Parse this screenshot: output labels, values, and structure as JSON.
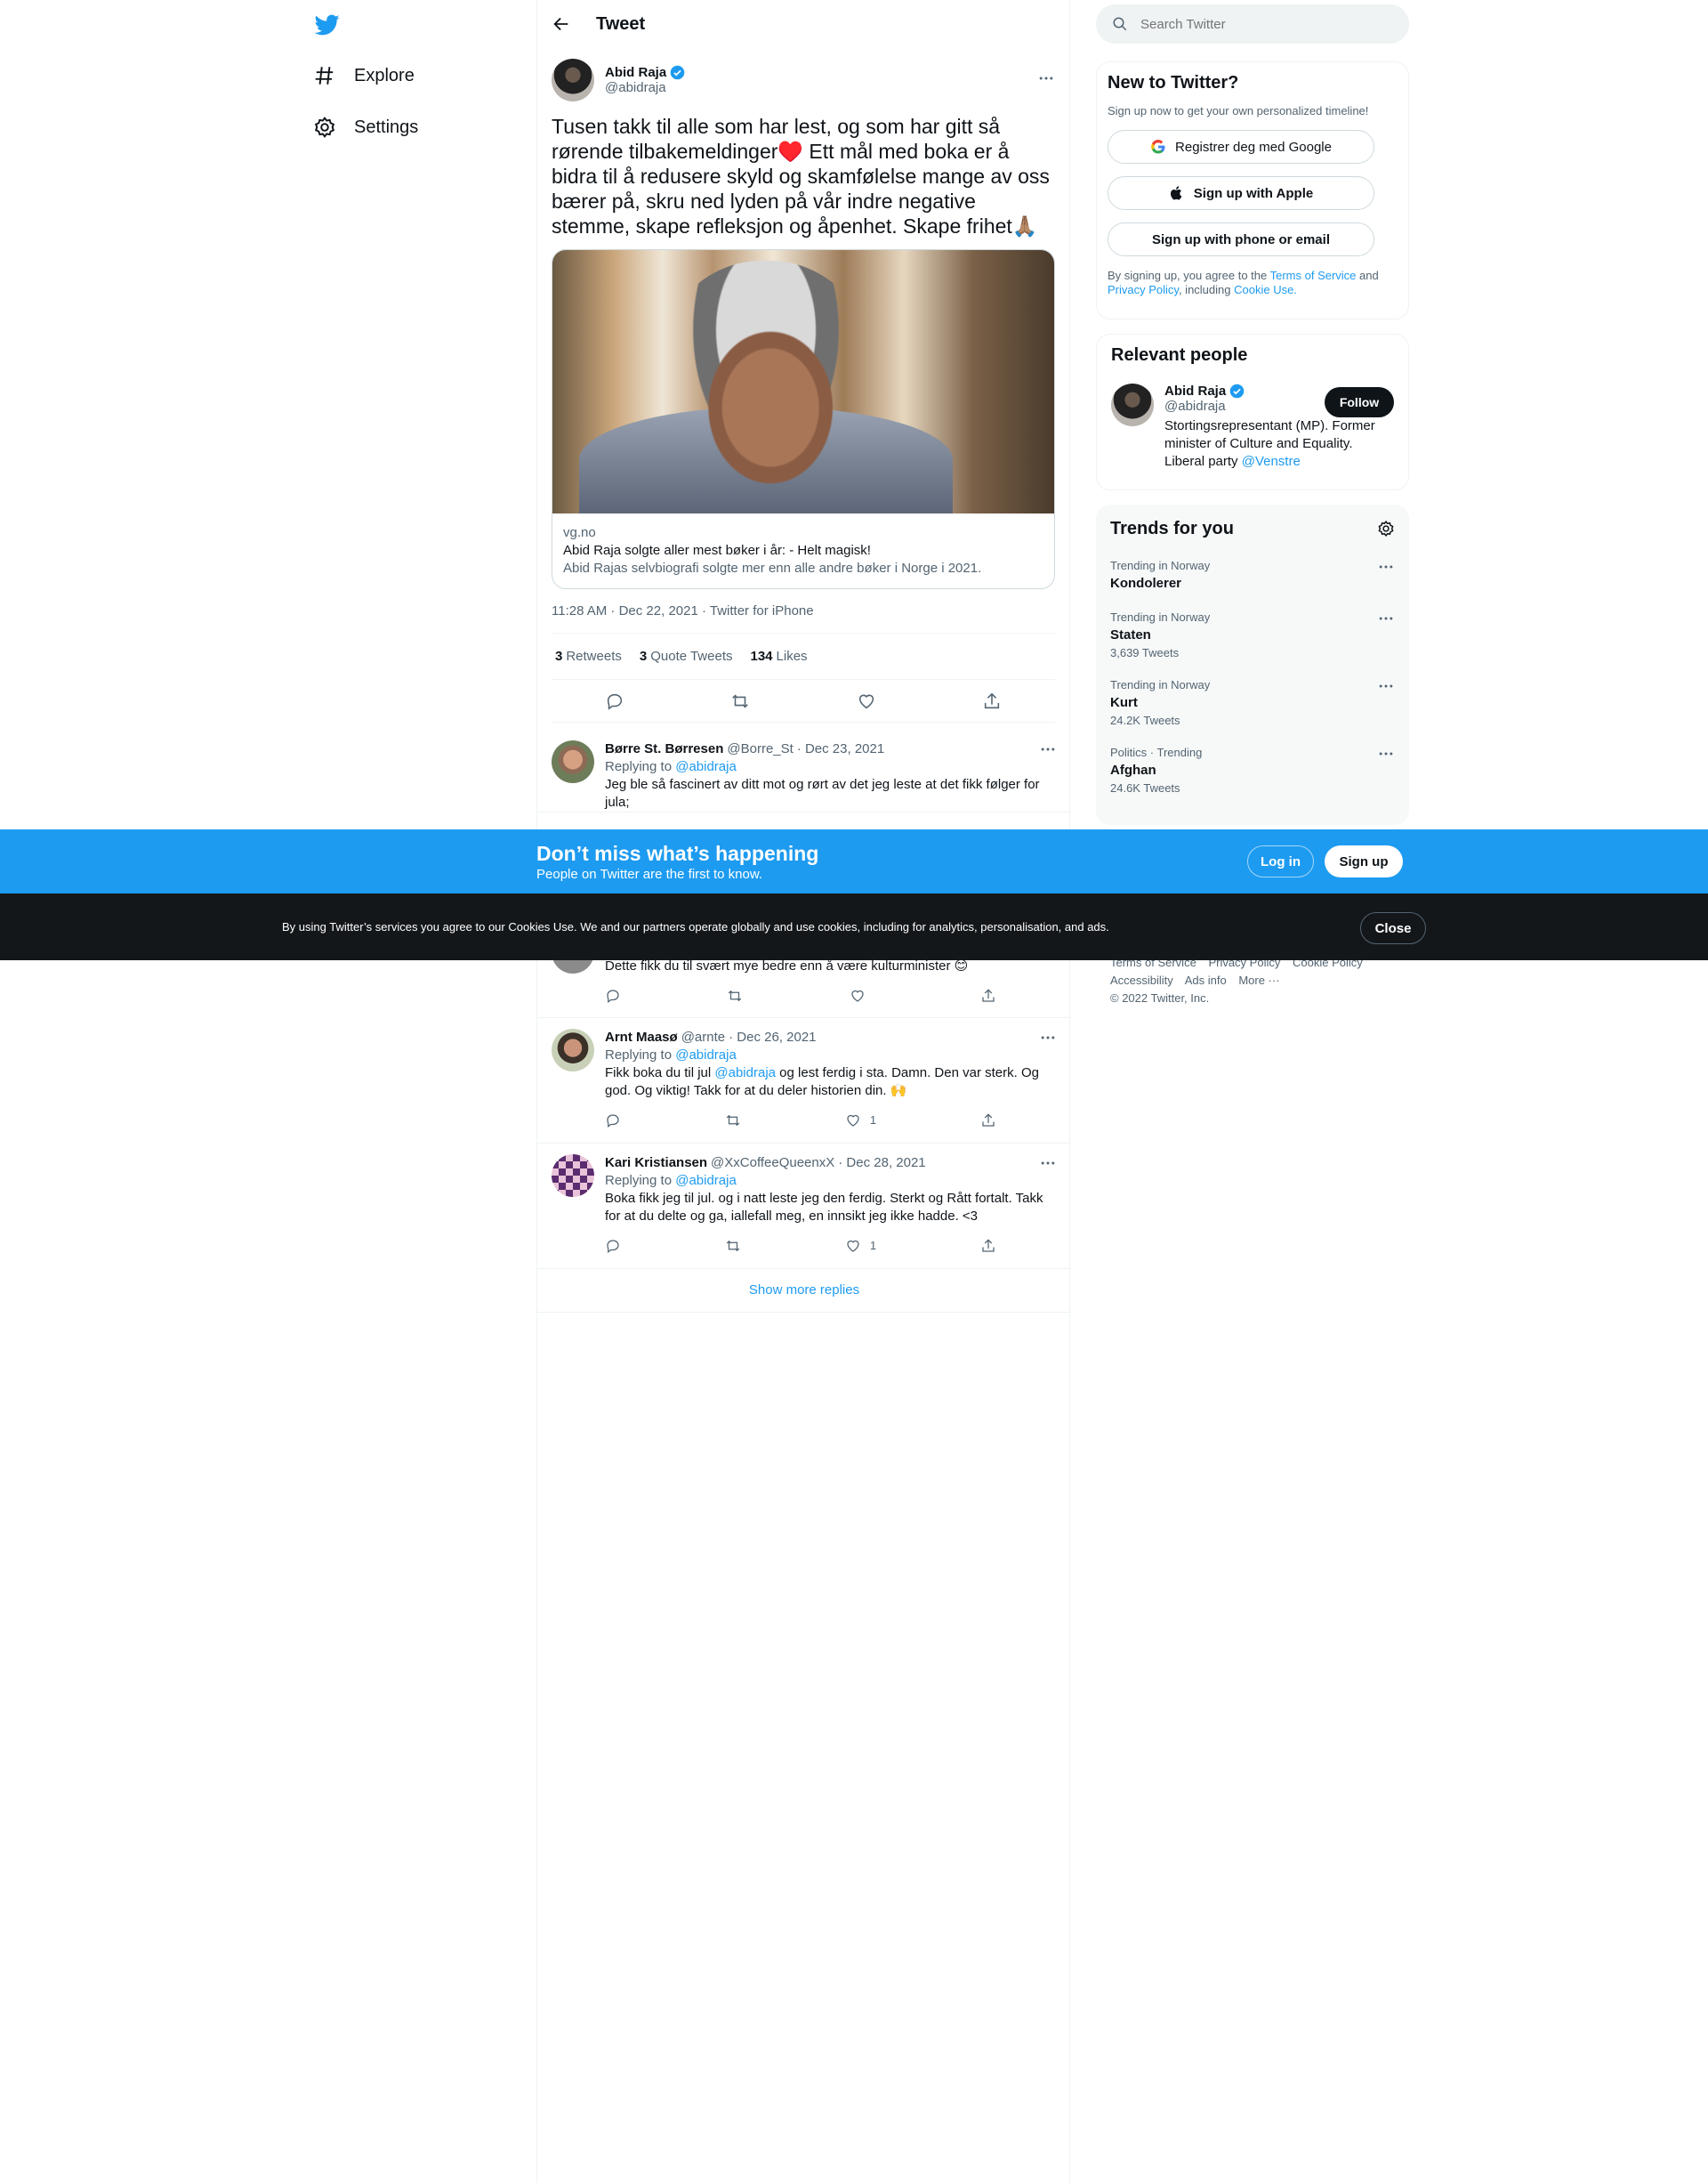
{
  "nav": {
    "explore_label": "Explore",
    "settings_label": "Settings"
  },
  "header": {
    "title": "Tweet"
  },
  "tweet": {
    "author_name": "Abid Raja",
    "author_handle": "@abidraja",
    "text": "Tusen takk til alle som har lest, og som har gitt så rørende tilbakemeldinger♥️ Ett mål med boka er å bidra til å redusere skyld og skamfølelse mange av oss bærer på, skru ned lyden på vår indre negative stemme, skape refleksjon og åpenhet. Skape frihet🙏🏽",
    "card": {
      "domain": "vg.no",
      "title": "Abid Raja solgte aller mest bøker i år: - Helt magisk!",
      "description": "Abid Rajas selvbiografi solgte mer enn alle andre bøker i Norge i 2021."
    },
    "meta": "11:28 AM · Dec 22, 2021 · Twitter for iPhone",
    "retweets_count": "3",
    "retweets_label": "Retweets",
    "quotes_count": "3",
    "quotes_label": "Quote Tweets",
    "likes_count": "134",
    "likes_label": "Likes"
  },
  "replies": [
    {
      "name": "Børre St. Børresen",
      "handle": "@Borre_St",
      "date": "· Dec 23, 2021",
      "replying_prefix": "Replying to ",
      "replying_to": "@abidraja",
      "text": "Jeg ble så fascinert av ditt mot og rørt av det jeg leste at det fikk følger for jula;",
      "likes": ""
    },
    {
      "text": "Dette fikk du til svært mye bedre enn å være kulturminister 😊",
      "likes": ""
    },
    {
      "name": "Arnt Maasø",
      "handle": "@arnte",
      "date": "· Dec 26, 2021",
      "replying_prefix": "Replying to ",
      "replying_to": "@abidraja",
      "text_before": "Fikk boka du til jul ",
      "text_mention": "@abidraja",
      "text_after": " og lest ferdig i sta. Damn. Den var sterk. Og god. Og viktig! Takk for at du deler historien din. 🙌",
      "likes": "1"
    },
    {
      "name": "Kari Kristiansen",
      "handle": "@XxCoffeeQueenxX",
      "date": "· Dec 28, 2021",
      "replying_prefix": "Replying to ",
      "replying_to": "@abidraja",
      "text": "Boka fikk jeg til jul. og i natt leste jeg den ferdig. Sterkt og Rått fortalt. Takk for at du delte og ga, iallefall meg, en innsikt jeg ikke hadde. <3",
      "likes": "1"
    }
  ],
  "show_more": "Show more replies",
  "search": {
    "placeholder": "Search Twitter"
  },
  "new_to_twitter": {
    "title": "New to Twitter?",
    "subtitle": "Sign up now to get your own personalized timeline!",
    "google_label": "Registrer deg med Google",
    "apple_label": "Sign up with Apple",
    "phone_label": "Sign up with phone or email",
    "legal_1": "By signing up, you agree to the ",
    "tos": "Terms of Service",
    "legal_2": " and ",
    "privacy": "Privacy Policy",
    "legal_3": ", including ",
    "cookie": "Cookie Use."
  },
  "relevant": {
    "title": "Relevant people",
    "name": "Abid Raja",
    "handle": "@abidraja",
    "follow_label": "Follow",
    "bio": "Stortingsrepresentant (MP). Former minister of Culture and Equality. Liberal party ",
    "bio_link": "@Venstre"
  },
  "trends": {
    "title": "Trends for you",
    "items": [
      {
        "context": "Trending in Norway",
        "name": "Kondolerer",
        "count": ""
      },
      {
        "context": "Trending in Norway",
        "name": "Staten",
        "count": "3,639 Tweets"
      },
      {
        "context": "Trending in Norway",
        "name": "Kurt",
        "count": "24.2K Tweets"
      },
      {
        "context": "Politics · Trending",
        "name": "Afghan",
        "count": "24.6K Tweets"
      }
    ]
  },
  "footer": {
    "tos": "Terms of Service",
    "privacy": "Privacy Policy",
    "cookie": "Cookie Policy",
    "accessibility": "Accessibility",
    "ads": "Ads info",
    "more": "More ···",
    "copyright": "© 2022 Twitter, Inc."
  },
  "banner": {
    "title": "Don’t miss what’s happening",
    "subtitle": "People on Twitter are the first to know.",
    "login_label": "Log in",
    "signup_label": "Sign up"
  },
  "cookie_bar": {
    "text": "By using Twitter’s services you agree to our Cookies Use. We and our partners operate globally and use cookies, including for analytics, personalisation, and ads.",
    "close_label": "Close"
  },
  "colors": {
    "accent": "#1d9bf0",
    "text": "#0f1419",
    "muted": "#536471"
  }
}
